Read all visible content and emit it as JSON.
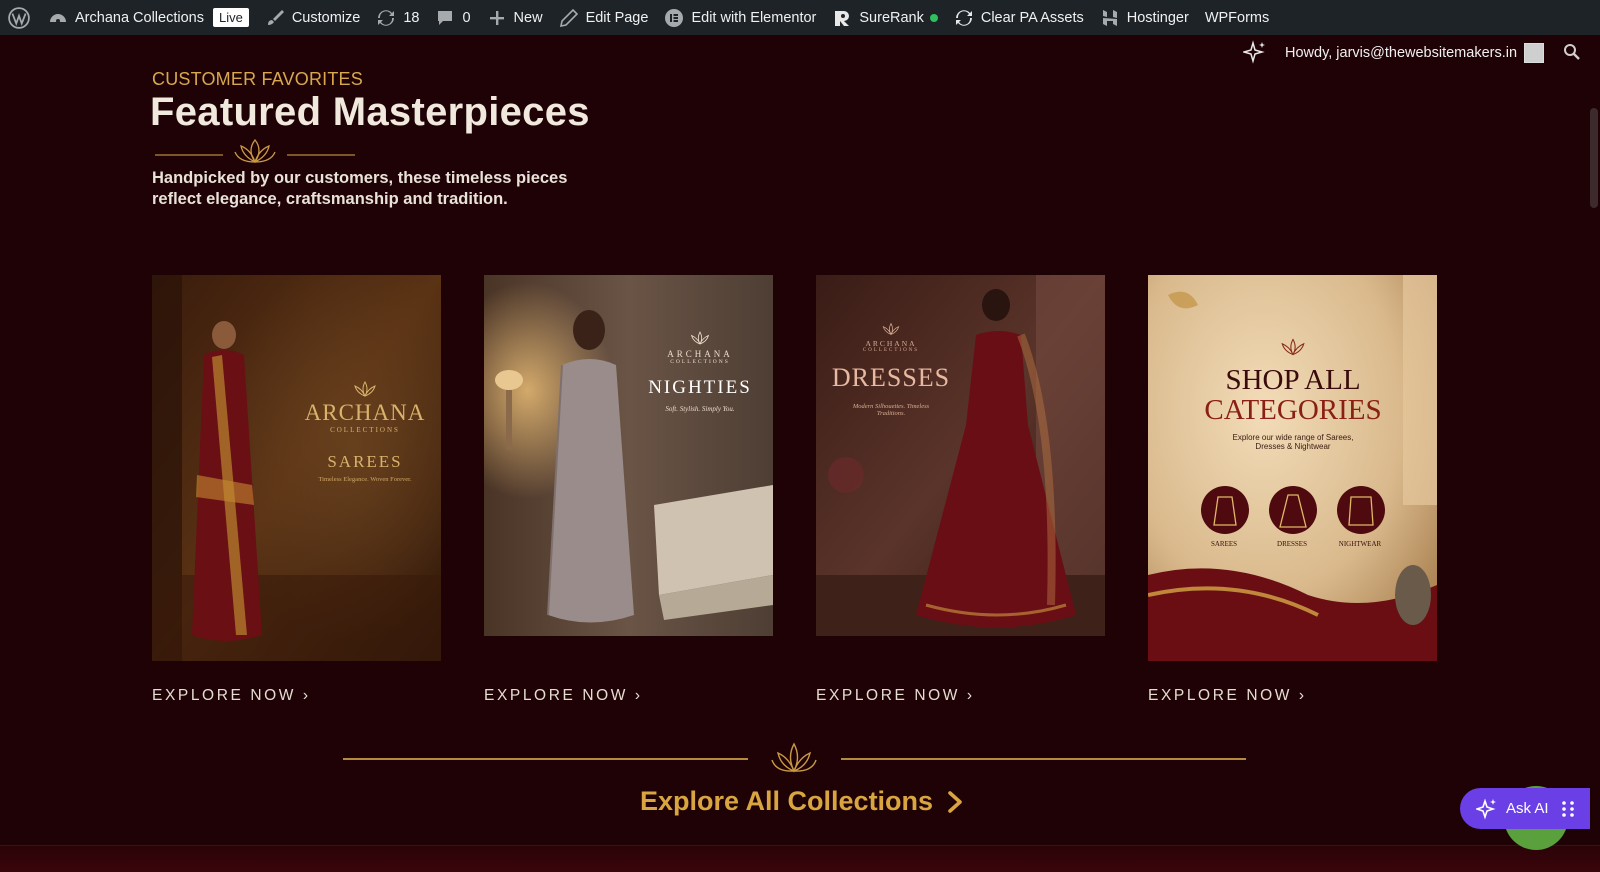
{
  "adminbar": {
    "site_name": "Archana Collections",
    "live_badge": "Live",
    "customize": "Customize",
    "updates_count": "18",
    "comments_count": "0",
    "new": "New",
    "edit_page": "Edit Page",
    "edit_elementor": "Edit with Elementor",
    "surerank": "SureRank",
    "clear_pa": "Clear PA Assets",
    "hostinger": "Hostinger",
    "wpforms": "WPForms",
    "howdy": "Howdy, jarvis@thewebsitemakers.in"
  },
  "hero": {
    "eyebrow": "CUSTOMER FAVORITES",
    "title": "Featured Masterpieces",
    "subtitle": "Handpicked by our customers, these timeless pieces reflect elegance, craftsmanship and tradition."
  },
  "cards": [
    {
      "brand": "ARCHANA",
      "brand_sub": "COLLECTIONS",
      "heading": "SAREES",
      "tagline": "Timeless Elegance. Woven Forever.",
      "cta": "EXPLORE NOW ›"
    },
    {
      "brand": "ARCHANA",
      "brand_sub": "COLLECTIONS",
      "heading": "NIGHTIES",
      "tagline": "Soft. Stylish. Simply You.",
      "cta": "EXPLORE NOW ›"
    },
    {
      "brand": "ARCHANA",
      "brand_sub": "COLLECTIONS",
      "heading": "DRESSES",
      "tagline": "Modern Silhouettes. Timeless Traditions.",
      "cta": "EXPLORE NOW ›"
    },
    {
      "heading_line1": "SHOP ALL",
      "heading_line2": "CATEGORIES",
      "tagline": "Explore our wide range of Sarees, Dresses & Nightwear",
      "cat1": "SAREES",
      "cat2": "DRESSES",
      "cat3": "NIGHTWEAR",
      "cta": "EXPLORE NOW ›"
    }
  ],
  "footer_cta": "Explore All Collections",
  "ask_ai": "Ask AI",
  "colors": {
    "page_bg": "#1f0205",
    "gold": "#d8a540",
    "admin_bar": "#1d2327",
    "ask_ai": "#6b3fe6"
  }
}
